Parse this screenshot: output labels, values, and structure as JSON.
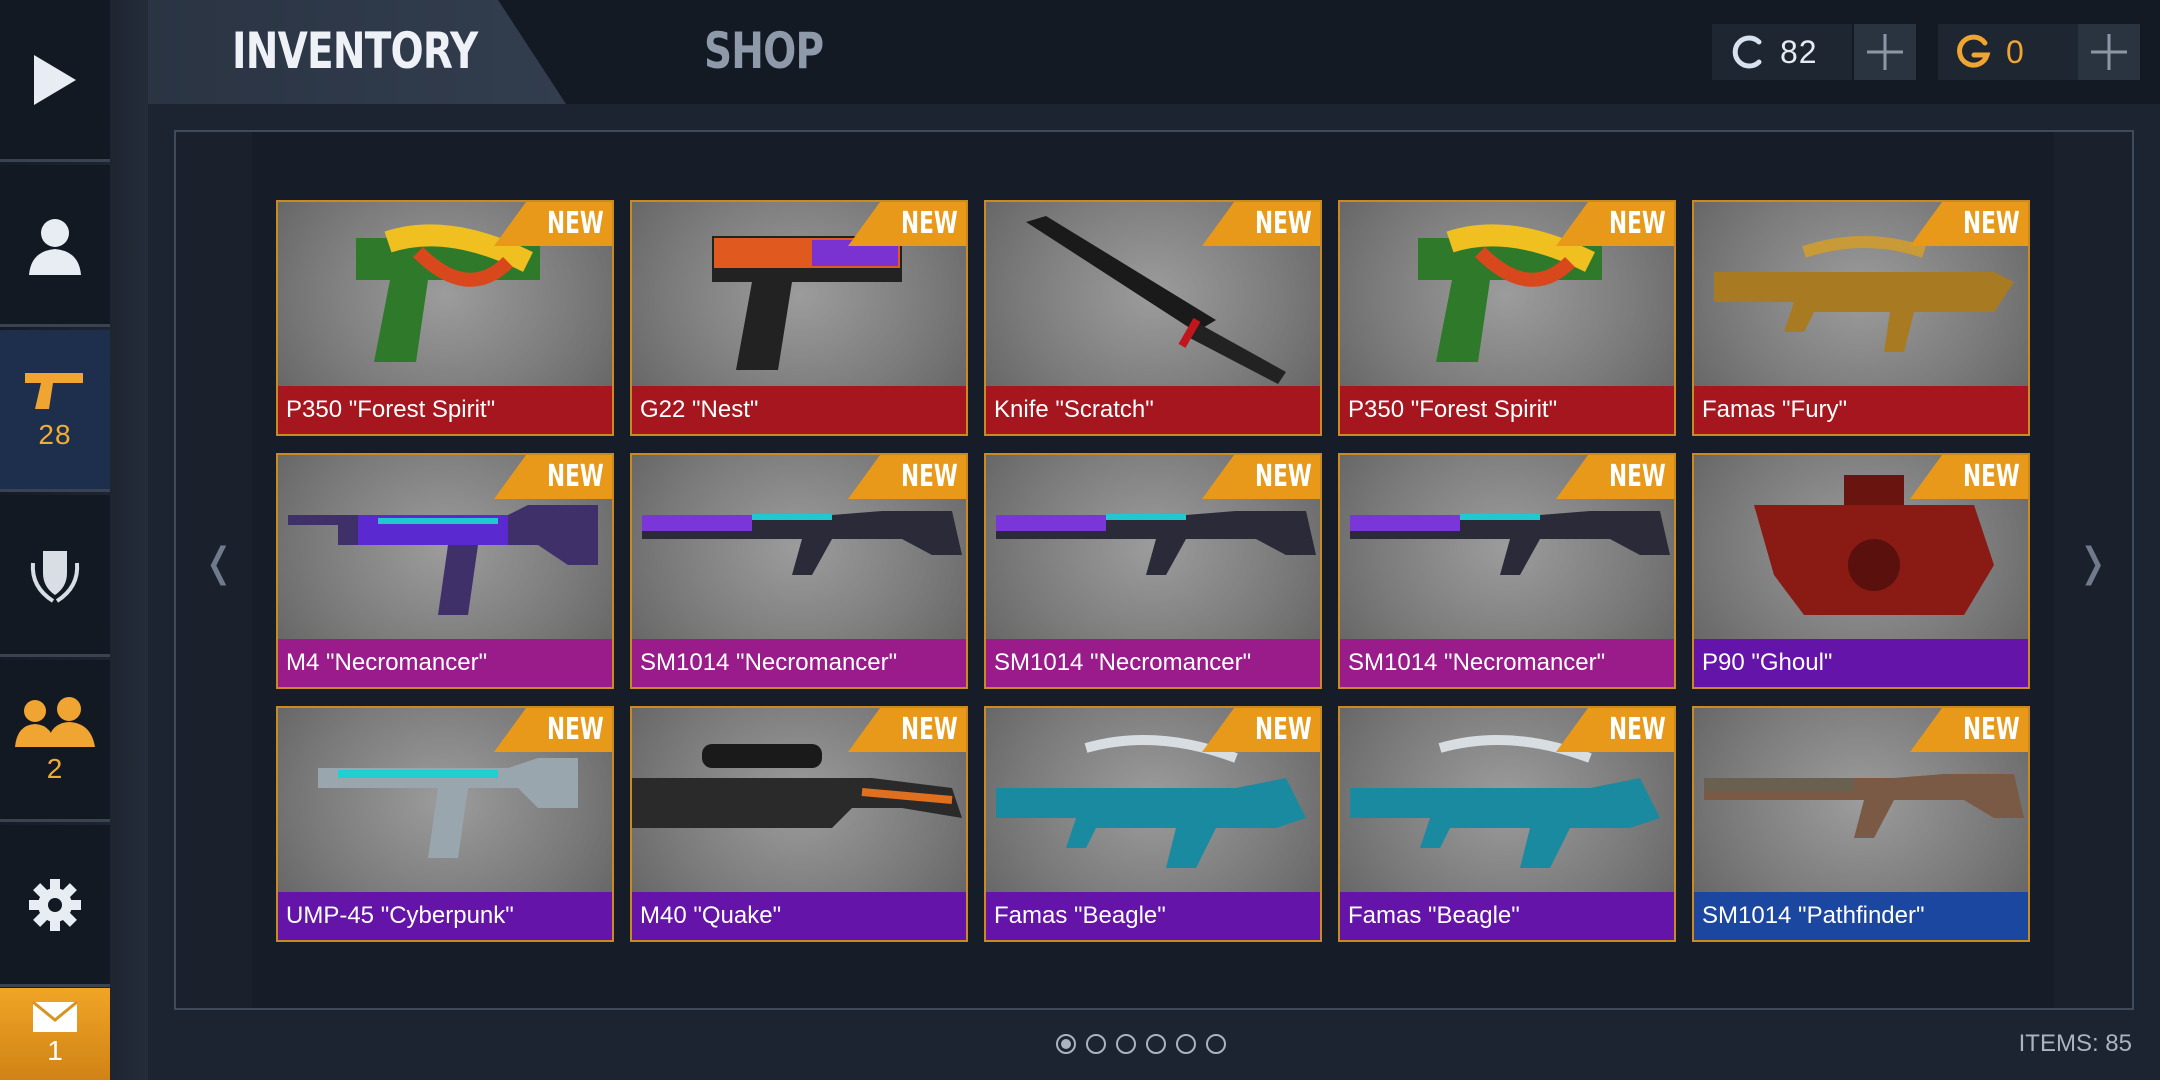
{
  "sidebar": {
    "items": [
      {
        "name": "play",
        "icon": "play-icon"
      },
      {
        "name": "profile",
        "icon": "profile-icon"
      },
      {
        "name": "inventory",
        "icon": "pistol-icon",
        "count": "28",
        "active": true
      },
      {
        "name": "clan",
        "icon": "shield-laurel-icon"
      },
      {
        "name": "friends",
        "icon": "friends-icon",
        "count": "2"
      },
      {
        "name": "settings",
        "icon": "gear-icon"
      }
    ],
    "mail": {
      "icon": "mail-icon",
      "count": "1"
    }
  },
  "tabs": {
    "inventory": "INVENTORY",
    "shop": "SHOP"
  },
  "currency": {
    "coins": {
      "icon": "coin-c-icon",
      "value": "82",
      "color": "#2f8fd8"
    },
    "gold": {
      "icon": "gold-g-icon",
      "value": "0",
      "color": "#f0a533"
    }
  },
  "inventory": {
    "badge": "NEW",
    "items": [
      {
        "name": "P350 \"Forest Spirit\"",
        "rarity": "red"
      },
      {
        "name": "G22 \"Nest\"",
        "rarity": "red"
      },
      {
        "name": "Knife \"Scratch\"",
        "rarity": "red"
      },
      {
        "name": "P350 \"Forest Spirit\"",
        "rarity": "red"
      },
      {
        "name": "Famas \"Fury\"",
        "rarity": "red"
      },
      {
        "name": "M4 \"Necromancer\"",
        "rarity": "pink"
      },
      {
        "name": "SM1014 \"Necromancer\"",
        "rarity": "pink"
      },
      {
        "name": "SM1014 \"Necromancer\"",
        "rarity": "pink"
      },
      {
        "name": "SM1014 \"Necromancer\"",
        "rarity": "pink"
      },
      {
        "name": "P90 \"Ghoul\"",
        "rarity": "purple"
      },
      {
        "name": "UMP-45 \"Cyberpunk\"",
        "rarity": "purple"
      },
      {
        "name": "M40 \"Quake\"",
        "rarity": "purple"
      },
      {
        "name": "Famas \"Beagle\"",
        "rarity": "purple"
      },
      {
        "name": "Famas \"Beagle\"",
        "rarity": "purple"
      },
      {
        "name": "SM1014 \"Pathfinder\"",
        "rarity": "blue"
      }
    ]
  },
  "pagination": {
    "pages": 6,
    "current": 1
  },
  "footer": {
    "items_count": "ITEMS: 85"
  },
  "colors": {
    "accent": "#e8991a",
    "rarity_red": "#a5161f",
    "rarity_pink": "#9a1c8a",
    "rarity_purple": "#6414a8",
    "rarity_blue": "#1c47a0"
  }
}
